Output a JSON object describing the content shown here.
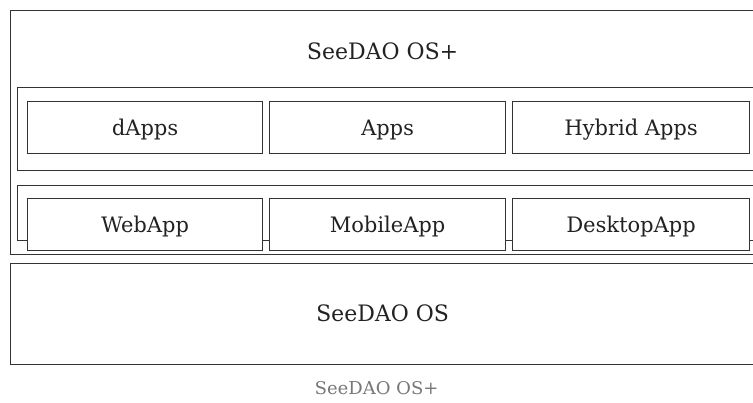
{
  "diagram": {
    "outer_title": "SeeDAO OS+",
    "row1": [
      "dApps",
      "Apps",
      "Hybrid Apps"
    ],
    "row2": [
      "WebApp",
      "MobileApp",
      "DesktopApp"
    ],
    "base_title": "SeeDAO OS",
    "caption": "SeeDAO OS+"
  }
}
